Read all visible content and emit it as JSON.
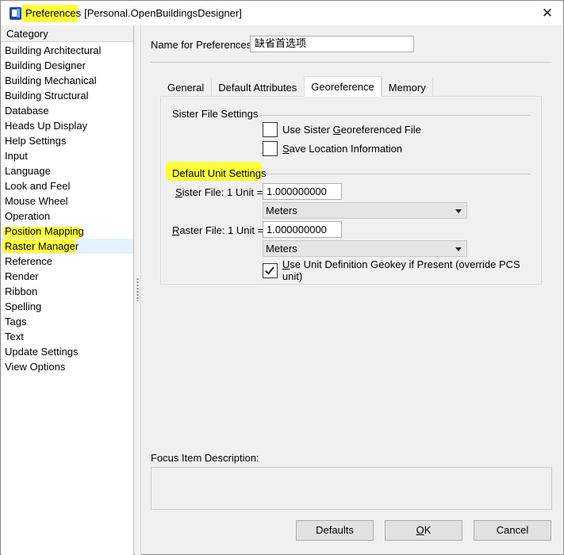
{
  "window": {
    "title": "Preferences",
    "subtitle": "[Personal.OpenBuildingsDesigner]"
  },
  "category": {
    "header": "Category",
    "items": [
      "Building Architectural",
      "Building Designer",
      "Building Mechanical",
      "Building Structural",
      "Database",
      "Heads Up Display",
      "Help Settings",
      "Input",
      "Language",
      "Look and Feel",
      "Mouse Wheel",
      "Operation",
      "Position Mapping",
      "Raster Manager",
      "Reference",
      "Render",
      "Ribbon",
      "Spelling",
      "Tags",
      "Text",
      "Update Settings",
      "View Options"
    ],
    "selected": "Raster Manager"
  },
  "name_field": {
    "label": "Name for Preferences:",
    "value": "缺省首选项"
  },
  "tabs": [
    "General",
    "Default Attributes",
    "Georeference",
    "Memory"
  ],
  "active_tab": "Georeference",
  "sister_group": {
    "title": "Sister File Settings",
    "use_sister_label": "Use Sister Georeferenced File",
    "use_sister_checked": false,
    "save_location_label": "Save Location Information",
    "save_location_checked": false
  },
  "unit_group": {
    "title": "Default Unit Settings",
    "sister_file_label": "Sister File: 1 Unit =",
    "sister_file_value": "1.000000000",
    "sister_units": "Meters",
    "raster_file_label": "Raster File: 1 Unit =",
    "raster_file_value": "1.000000000",
    "raster_units": "Meters",
    "geokey_label": "Use Unit Definition Geokey if Present (override PCS unit)",
    "geokey_checked": true
  },
  "focus": {
    "label": "Focus Item Description:",
    "text": ""
  },
  "buttons": {
    "defaults": "Defaults",
    "ok": "OK",
    "cancel": "Cancel"
  },
  "colors": {
    "highlight": "#ffff3c",
    "selection": "#e5f1fb"
  }
}
